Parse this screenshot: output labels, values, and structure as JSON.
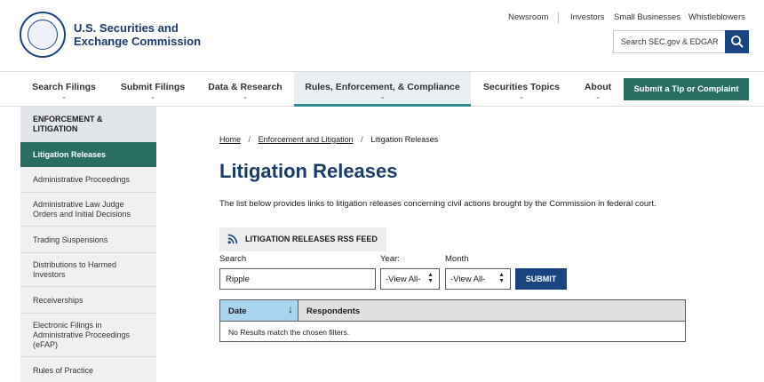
{
  "header": {
    "agency_line1": "U.S. Securities and",
    "agency_line2": "Exchange Commission",
    "utility_links": [
      "Newsroom",
      "Investors",
      "Small Businesses",
      "Whistleblowers"
    ],
    "search_placeholder": "Search SEC.gov & EDGAR"
  },
  "nav": {
    "items": [
      "Search Filings",
      "Submit Filings",
      "Data & Research",
      "Rules, Enforcement, & Compliance",
      "Securities Topics",
      "About"
    ],
    "active_index": 3,
    "tip_button": "Submit a Tip or Complaint",
    "colors": {
      "accent": "#2a6e63",
      "brand": "#1a4480",
      "active_bg": "#eaeff3"
    }
  },
  "sidebar": {
    "heading_line1": "ENFORCEMENT &",
    "heading_line2": "LITIGATION",
    "items": [
      {
        "line1": "Litigation Releases",
        "line2": "",
        "line3": "",
        "active": true
      },
      {
        "line1": "Administrative Proceedings",
        "line2": "",
        "line3": ""
      },
      {
        "line1": "Administrative Law Judge",
        "line2": "Orders and Initial Decisions",
        "line3": ""
      },
      {
        "line1": "Trading Suspensions",
        "line2": "",
        "line3": ""
      },
      {
        "line1": "Distributions to Harmed",
        "line2": "Investors",
        "line3": ""
      },
      {
        "line1": "Receiverships",
        "line2": "",
        "line3": ""
      },
      {
        "line1": "Electronic Filings in",
        "line2": "Administrative Proceedings",
        "line3": "(eFAP)"
      },
      {
        "line1": "Rules of Practice",
        "line2": "",
        "line3": ""
      }
    ]
  },
  "breadcrumb": {
    "home": "Home",
    "parent": "Enforcement and Litigation",
    "current": "Litigation Releases",
    "separator": "/"
  },
  "main": {
    "title": "Litigation Releases",
    "intro": "The list below provides links to litigation releases concerning civil actions brought by the Commission in federal court.",
    "rss_label": "LITIGATION RELEASES RSS FEED"
  },
  "filters": {
    "search_label": "Search",
    "search_value": "Ripple",
    "year_label": "Year:",
    "year_value": "-View All-",
    "month_label": "Month",
    "month_value": "-View All-",
    "submit_label": "SUBMIT"
  },
  "table": {
    "columns": [
      "Date",
      "Respondents"
    ],
    "sort_column": "Date",
    "sort_direction": "descending",
    "empty_message": "No Results match the chosen filters."
  }
}
